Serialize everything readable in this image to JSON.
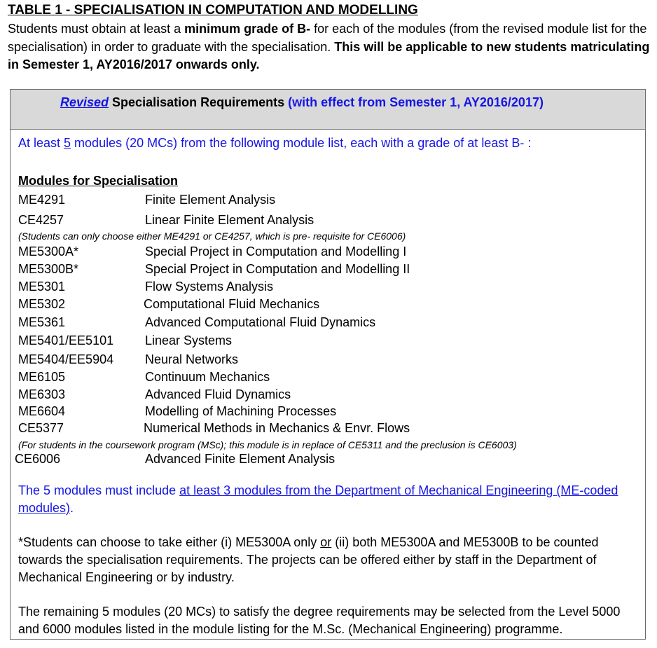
{
  "document": {
    "title": "TABLE 1 - SPECIALISATION IN COMPUTATION AND MODELLING",
    "intro": {
      "part1": "Students must obtain at least a ",
      "bold1": "minimum grade of B-",
      "part2": " for each of the modules (from the revised module list for the specialisation) in order to graduate with the specialisation. ",
      "bold2": "This will be applicable to new students matriculating in Semester 1, AY2016/2017 onwards only."
    }
  },
  "table": {
    "header": {
      "revised": "Revised",
      "label": " Specialisation Requirements ",
      "effect": "(with effect from Semester 1, AY2016/2017)"
    },
    "requirement": {
      "pre": "At least ",
      "count": "5",
      "post": " modules (20 MCs) from the following module list, each with a grade of at least B- :"
    },
    "modules_heading": "Modules for Specialisation",
    "modules": [
      {
        "code": "ME4291",
        "name": "Finite Element Analysis"
      },
      {
        "code": "CE4257",
        "name": "Linear Finite Element Analysis"
      },
      {
        "code": "ME5300A*",
        "name": "Special Project in Computation and Modelling I"
      },
      {
        "code": "ME5300B*",
        "name": "Special Project in Computation and Modelling II"
      },
      {
        "code": "ME5301",
        "name": "Flow Systems Analysis"
      },
      {
        "code": "ME5302",
        "name": "Computational Fluid Mechanics"
      },
      {
        "code": "ME5361",
        "name": "Advanced Computational Fluid Dynamics"
      },
      {
        "code": "ME5401/EE5101",
        "name": "Linear Systems"
      },
      {
        "code": "ME5404/EE5904",
        "name": "Neural Networks"
      },
      {
        "code": "ME6105",
        "name": "Continuum Mechanics"
      },
      {
        "code": "ME6303",
        "name": "Advanced Fluid Dynamics"
      },
      {
        "code": "ME6604",
        "name": "Modelling of Machining Processes"
      },
      {
        "code": "CE5377",
        "name": "Numerical Methods in Mechanics & Envr. Flows"
      },
      {
        "code": "CE6006",
        "name": "Advanced Finite Element Analysis"
      }
    ],
    "note1": "(Students can only choose either ME4291 or CE4257, which is pre- requisite for CE6006)",
    "note2": "(For students in the coursework program (MSc); this module is in replace of CE5311 and the preclusion is CE6003)",
    "include": {
      "pre": "The 5 modules must include ",
      "link": "at least 3 modules from the Department of Mechanical Engineering (ME-coded modules)",
      "post": "."
    },
    "choose": {
      "pre": "*Students can choose to take either (i) ME5300A only ",
      "or": "or",
      "post": " (ii) both ME5300A and ME5300B to be counted towards the specialisation requirements. The projects can be offered either by staff in the Department of Mechanical Engineering or by industry."
    },
    "remaining": "The remaining 5 modules (20 MCs) to satisfy the degree requirements may be selected from the Level 5000 and 6000 modules listed in the module listing for the M.Sc. (Mechanical Engineering) programme."
  }
}
